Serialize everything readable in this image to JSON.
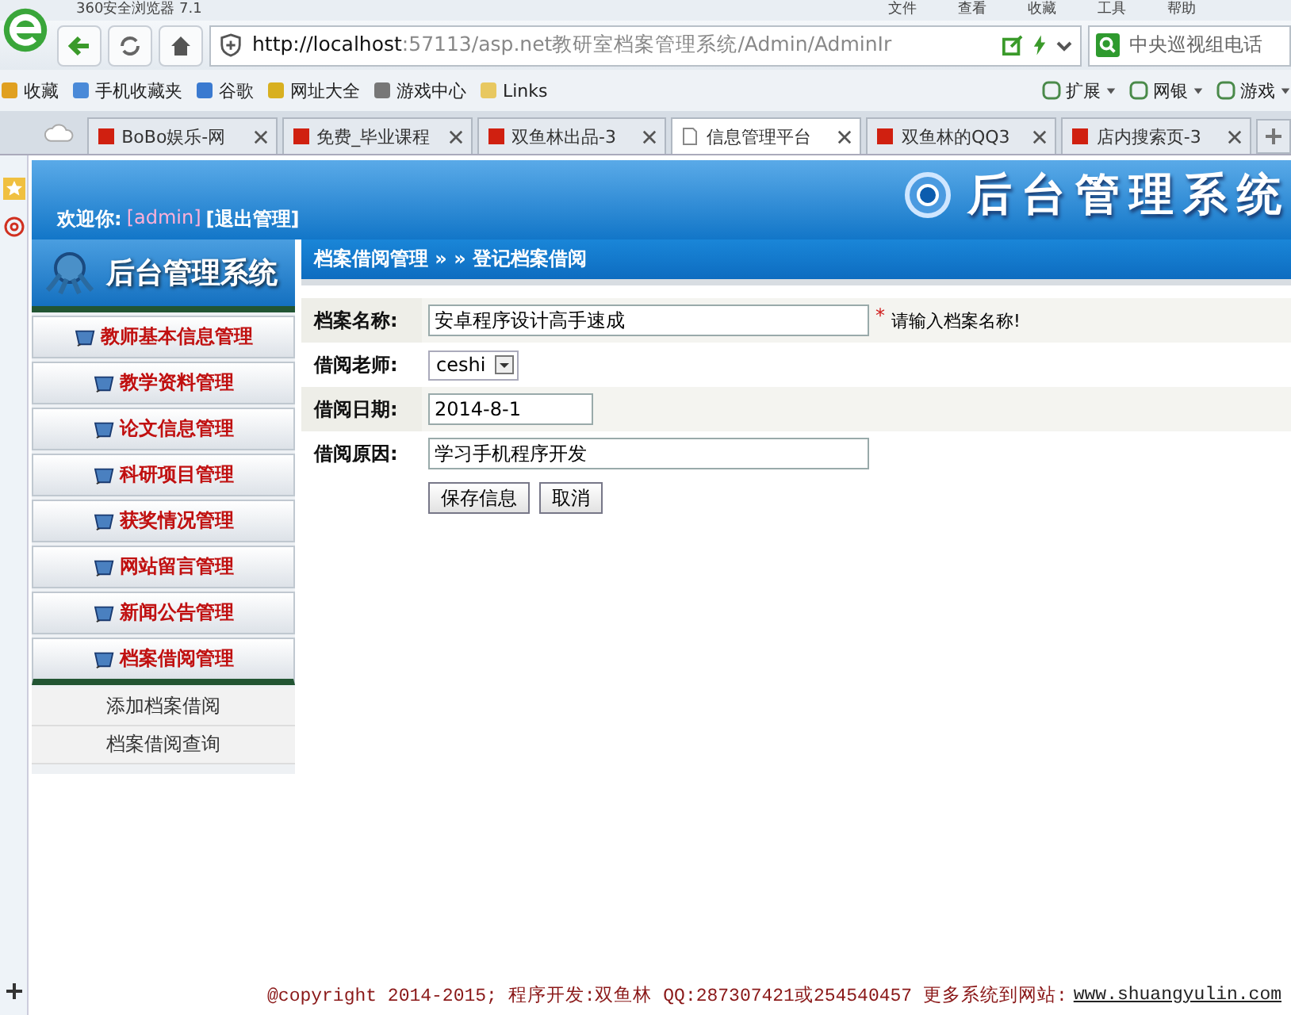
{
  "browser": {
    "title": "360安全浏览器 7.1",
    "menu": [
      "文件",
      "查看",
      "收藏",
      "工具",
      "帮助"
    ],
    "url_host": "http://localhost",
    "url_rest": ":57113/asp.net教研室档案管理系统/Admin/AdminIr",
    "search": "中央巡视组电话",
    "bookmarks": [
      "收藏",
      "手机收藏夹",
      "谷歌",
      "网址大全",
      "游戏中心",
      "Links"
    ],
    "bookmarks_right": [
      "扩展",
      "网银",
      "游戏"
    ],
    "tabs": [
      {
        "label": "BoBo娱乐-网",
        "selected": false
      },
      {
        "label": "免费_毕业课程",
        "selected": false
      },
      {
        "label": "双鱼林出品-3",
        "selected": false
      },
      {
        "label": "信息管理平台",
        "selected": true
      },
      {
        "label": "双鱼林的QQ3",
        "selected": false
      },
      {
        "label": "店内搜索页-3",
        "selected": false
      }
    ]
  },
  "page": {
    "welcome": "欢迎你:",
    "user": "[admin]",
    "logout": "[退出管理]",
    "header_title": "后台管理系统",
    "logo_title": "后台管理系统",
    "breadcrumb": "档案借阅管理 » » 登记档案借阅",
    "menu": [
      {
        "label": "教师基本信息管理",
        "expanded": false
      },
      {
        "label": "教学资料管理",
        "expanded": false
      },
      {
        "label": "论文信息管理",
        "expanded": false
      },
      {
        "label": "科研项目管理",
        "expanded": false
      },
      {
        "label": "获奖情况管理",
        "expanded": false
      },
      {
        "label": "网站留言管理",
        "expanded": false
      },
      {
        "label": "新闻公告管理",
        "expanded": false
      },
      {
        "label": "档案借阅管理",
        "expanded": true,
        "children": [
          {
            "label": "添加档案借阅"
          },
          {
            "label": "档案借阅查询"
          }
        ]
      }
    ],
    "form": {
      "fields": [
        {
          "kind": "text",
          "label": "档案名称:",
          "value": "安卓程序设计高手速成",
          "mark": "*",
          "hint": "请输入档案名称!"
        },
        {
          "kind": "select",
          "label": "借阅老师:",
          "value": "ceshi"
        },
        {
          "kind": "date",
          "label": "借阅日期:",
          "value": "2014-8-1"
        },
        {
          "kind": "text",
          "label": "借阅原因:",
          "value": "学习手机程序开发"
        }
      ],
      "buttons": [
        "保存信息",
        "取消"
      ]
    },
    "footer": {
      "text": "@copyright 2014-2015; 程序开发:双鱼林  QQ:287307421或254540457  更多系统到网站:",
      "link": "www.shuangyulin.com"
    }
  }
}
